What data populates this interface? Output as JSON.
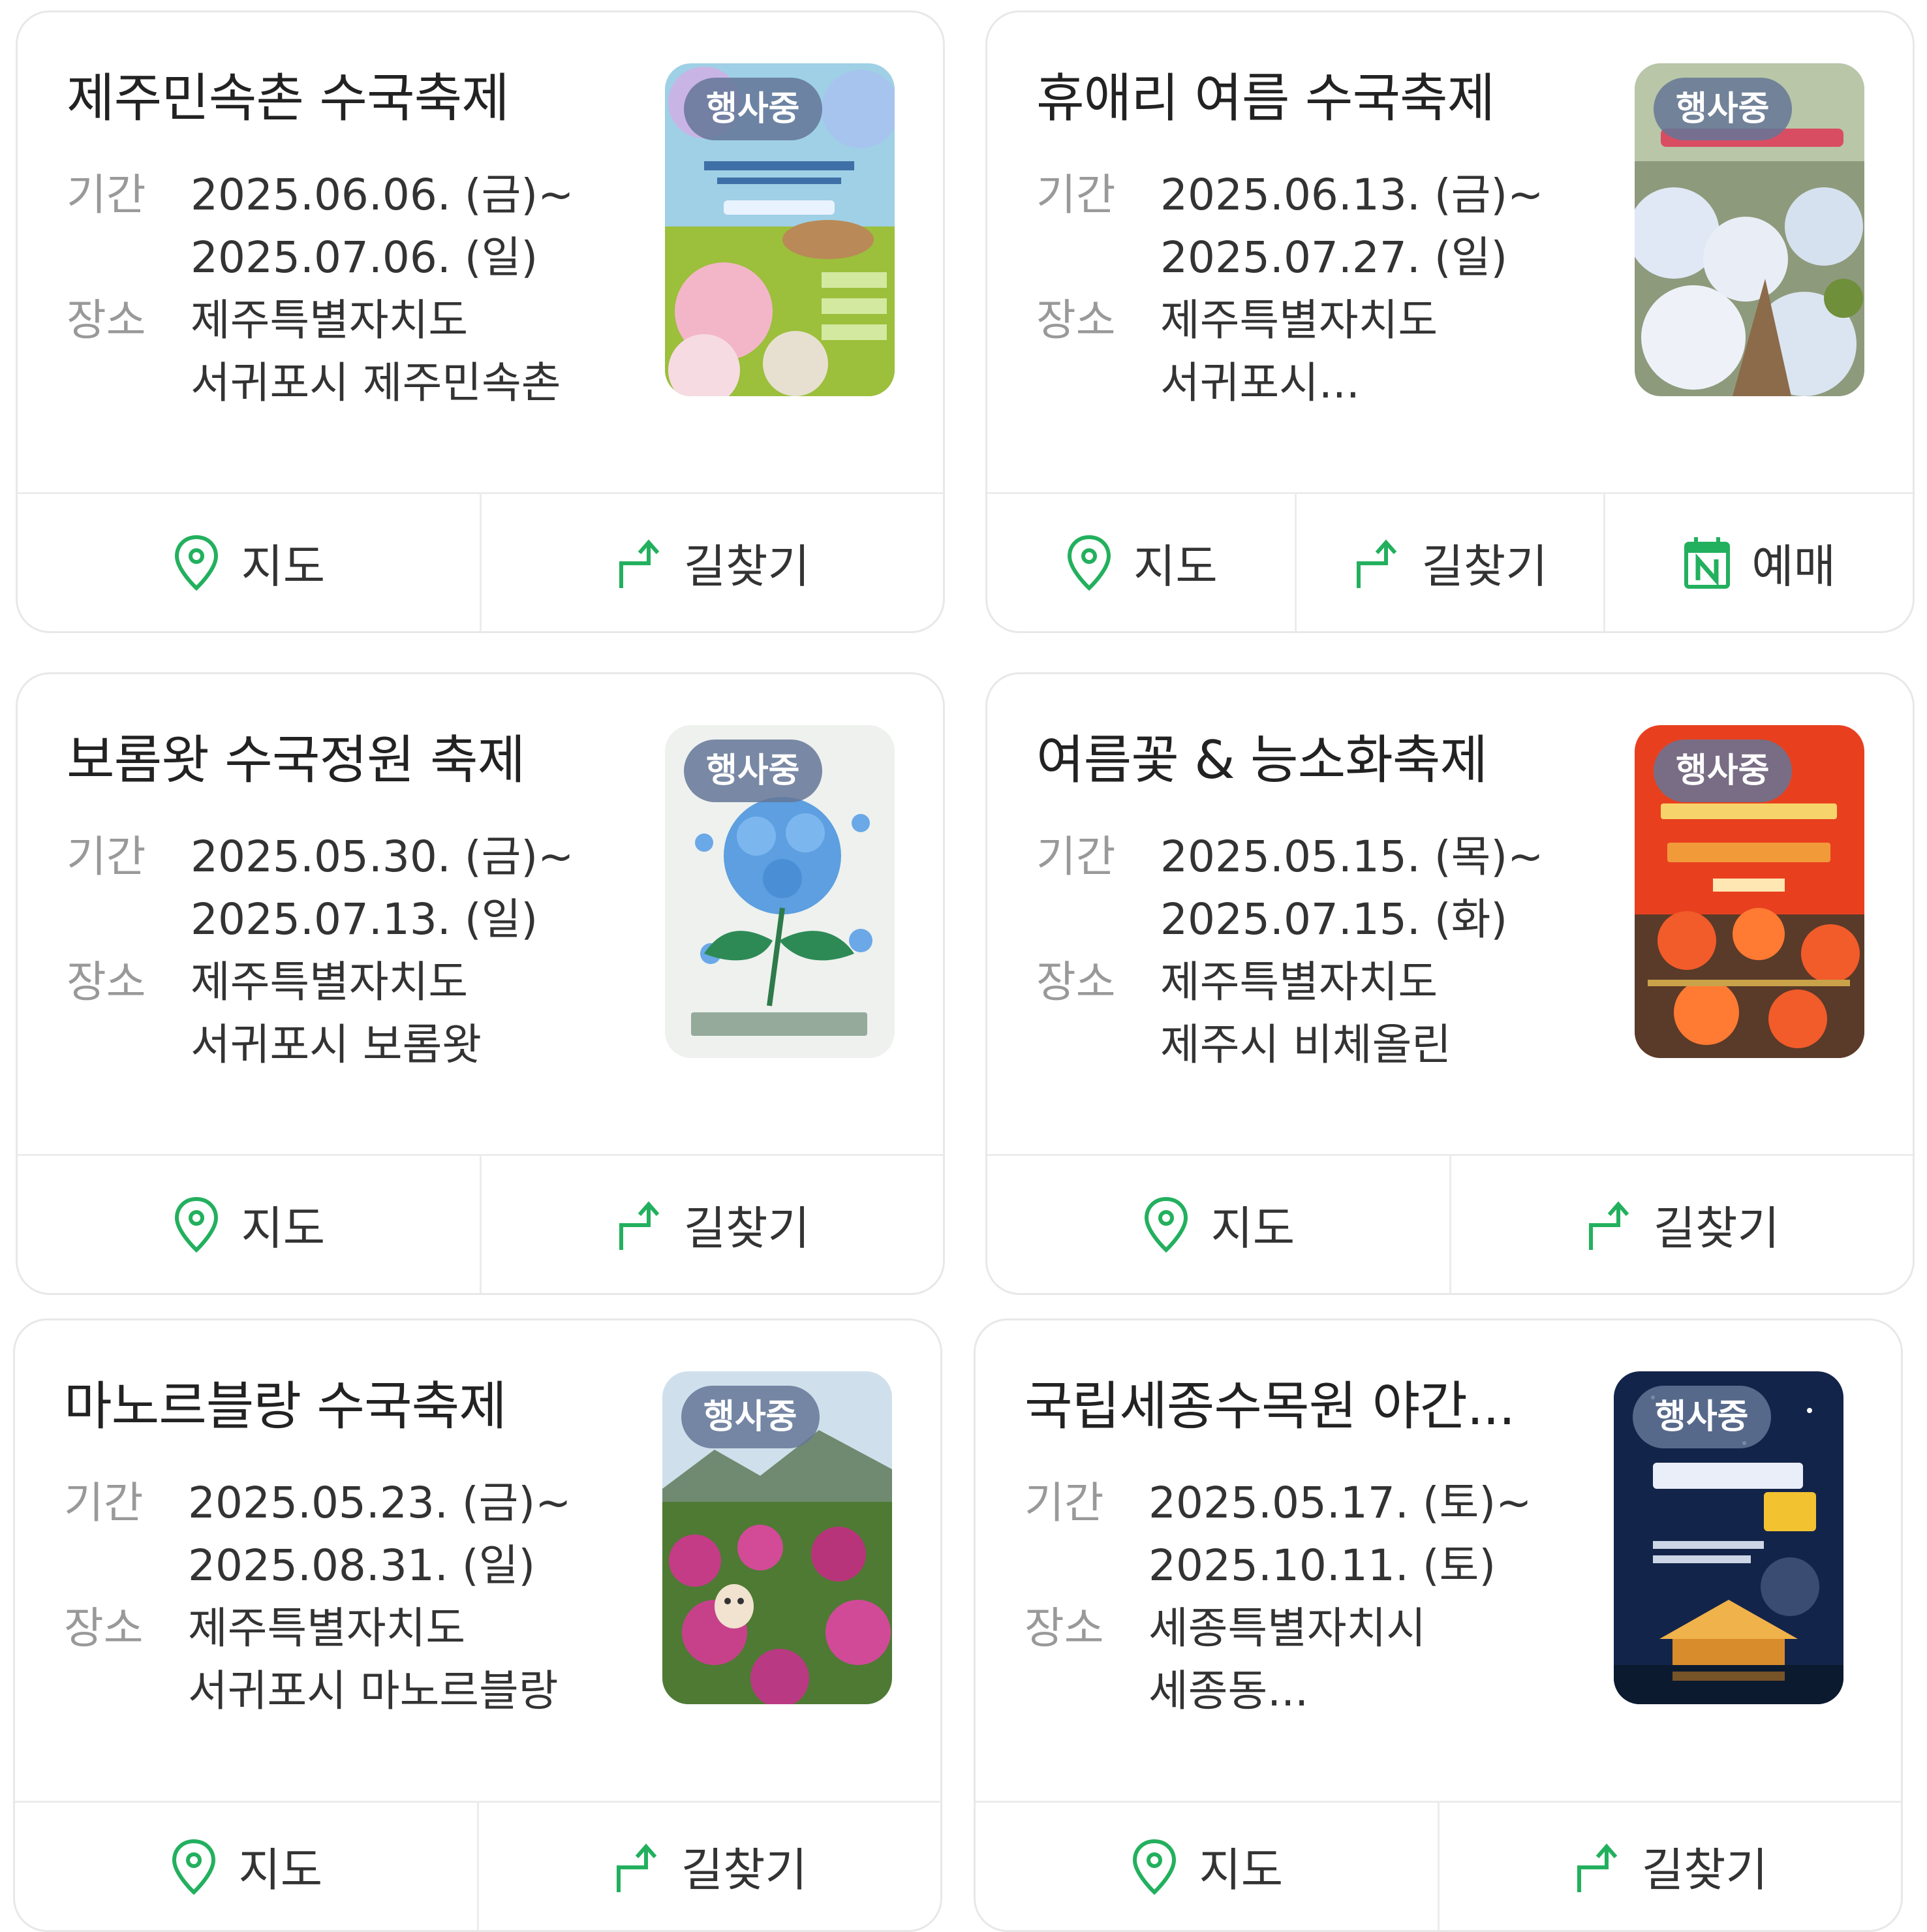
{
  "colors": {
    "accent": "#23b05e",
    "badge": "#647696",
    "border": "#e8e8e8",
    "label": "#999999"
  },
  "labels": {
    "period": "기간",
    "place": "장소",
    "map": "지도",
    "route": "길찾기",
    "booking": "예매",
    "status": "행사중"
  },
  "icons": {
    "map": "map-pin-icon",
    "route": "turn-arrow-icon",
    "booking": "naver-calendar-icon"
  },
  "festivals": [
    {
      "title": "제주민속촌 수국축제",
      "date_start": "2025.06.06. (금)~",
      "date_end": "2025.07.06. (일)",
      "place_1": "제주특별자치도",
      "place_2": "서귀포시 제주민속촌",
      "image": "hydrangea-poster-thumbnail"
    },
    {
      "title": "휴애리 여름 수국축제",
      "date_start": "2025.06.13. (금)~",
      "date_end": "2025.07.27. (일)",
      "place_1": "제주특별자치도",
      "place_2": "서귀포시...",
      "image": "hydrangea-garden-thumbnail"
    },
    {
      "title": "보롬왓 수국정원 축제",
      "date_start": "2025.05.30. (금)~",
      "date_end": "2025.07.13. (일)",
      "place_1": "제주특별자치도",
      "place_2": "서귀포시 보롬왓",
      "image": "hydrangea-illustration-thumbnail"
    },
    {
      "title": "여름꽃 & 능소화축제",
      "date_start": "2025.05.15. (목)~",
      "date_end": "2025.07.15. (화)",
      "place_1": "제주특별자치도",
      "place_2": "제주시 비체올린",
      "image": "trumpet-vine-poster-thumbnail"
    },
    {
      "title": "마노르블랑 수국축제",
      "date_start": "2025.05.23. (금)~",
      "date_end": "2025.08.31. (일)",
      "place_1": "제주특별자치도",
      "place_2": "서귀포시 마노르블랑",
      "image": "pink-hydrangea-field-thumbnail"
    },
    {
      "title": "국립세종수목원 야간...",
      "date_start": "2025.05.17. (토)~",
      "date_end": "2025.10.11. (토)",
      "place_1": "세종특별자치시",
      "place_2": "세종동...",
      "image": "night-arboretum-poster-thumbnail"
    }
  ]
}
